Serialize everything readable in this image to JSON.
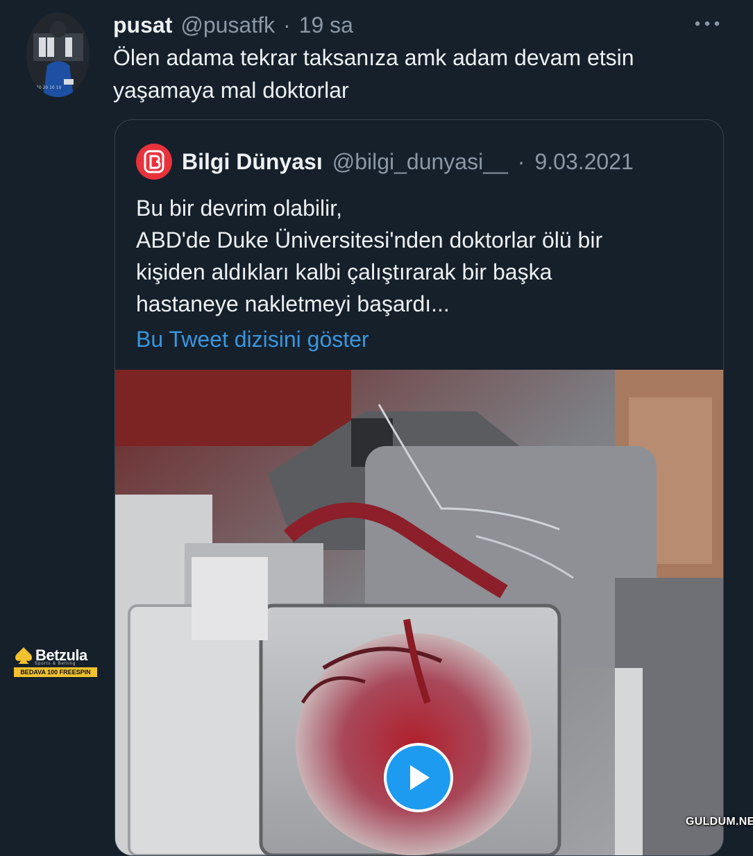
{
  "tweet": {
    "display_name": "pusat",
    "handle": "@pusatfk",
    "separator": "·",
    "time": "19 sa",
    "text": "Ölen adama tekrar taksanıza amk adam devam etsin yaşamaya mal doktorlar",
    "more_icon": "ellipsis-icon"
  },
  "quoted_tweet": {
    "avatar_icon": "b-logo-icon",
    "display_name": "Bilgi Dünyası",
    "handle": "@bilgi_dunyasi__",
    "separator": "·",
    "date": "9.03.2021",
    "text_lines": [
      "Bu bir devrim olabilir,",
      "ABD'de Duke Üniversitesi'nden doktorlar ölü bir",
      "kişiden aldıkları kalbi çalıştırarak bir başka",
      "hastaneye nakletmeyi başardı..."
    ],
    "show_thread": "Bu Tweet dizisini göster",
    "media": {
      "type": "video",
      "play_icon": "play-icon"
    }
  },
  "overlays": {
    "ad_brand": "Betzula",
    "ad_tagline": "Sports & Betting",
    "ad_promo": "BEDAVA 100 FREESPIN",
    "watermark": "GULDUM.NET"
  },
  "colors": {
    "background": "#15202b",
    "link": "#3a96dd",
    "secondary_text": "#8b98a5",
    "quote_avatar": "#e8323c",
    "play_button": "#1d9bf0",
    "ad_promo_bg": "#f2c12e"
  }
}
